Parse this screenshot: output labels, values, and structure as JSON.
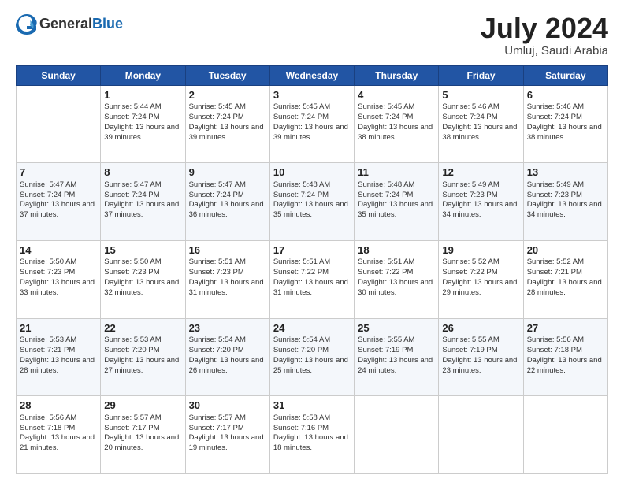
{
  "header": {
    "logo_general": "General",
    "logo_blue": "Blue",
    "month_title": "July 2024",
    "location": "Umluj, Saudi Arabia"
  },
  "days_of_week": [
    "Sunday",
    "Monday",
    "Tuesday",
    "Wednesday",
    "Thursday",
    "Friday",
    "Saturday"
  ],
  "weeks": [
    [
      {
        "day": null,
        "data": null
      },
      {
        "day": 1,
        "sunrise": "Sunrise: 5:44 AM",
        "sunset": "Sunset: 7:24 PM",
        "daylight": "Daylight: 13 hours and 39 minutes."
      },
      {
        "day": 2,
        "sunrise": "Sunrise: 5:45 AM",
        "sunset": "Sunset: 7:24 PM",
        "daylight": "Daylight: 13 hours and 39 minutes."
      },
      {
        "day": 3,
        "sunrise": "Sunrise: 5:45 AM",
        "sunset": "Sunset: 7:24 PM",
        "daylight": "Daylight: 13 hours and 39 minutes."
      },
      {
        "day": 4,
        "sunrise": "Sunrise: 5:45 AM",
        "sunset": "Sunset: 7:24 PM",
        "daylight": "Daylight: 13 hours and 38 minutes."
      },
      {
        "day": 5,
        "sunrise": "Sunrise: 5:46 AM",
        "sunset": "Sunset: 7:24 PM",
        "daylight": "Daylight: 13 hours and 38 minutes."
      },
      {
        "day": 6,
        "sunrise": "Sunrise: 5:46 AM",
        "sunset": "Sunset: 7:24 PM",
        "daylight": "Daylight: 13 hours and 38 minutes."
      }
    ],
    [
      {
        "day": 7,
        "sunrise": "Sunrise: 5:47 AM",
        "sunset": "Sunset: 7:24 PM",
        "daylight": "Daylight: 13 hours and 37 minutes."
      },
      {
        "day": 8,
        "sunrise": "Sunrise: 5:47 AM",
        "sunset": "Sunset: 7:24 PM",
        "daylight": "Daylight: 13 hours and 37 minutes."
      },
      {
        "day": 9,
        "sunrise": "Sunrise: 5:47 AM",
        "sunset": "Sunset: 7:24 PM",
        "daylight": "Daylight: 13 hours and 36 minutes."
      },
      {
        "day": 10,
        "sunrise": "Sunrise: 5:48 AM",
        "sunset": "Sunset: 7:24 PM",
        "daylight": "Daylight: 13 hours and 35 minutes."
      },
      {
        "day": 11,
        "sunrise": "Sunrise: 5:48 AM",
        "sunset": "Sunset: 7:24 PM",
        "daylight": "Daylight: 13 hours and 35 minutes."
      },
      {
        "day": 12,
        "sunrise": "Sunrise: 5:49 AM",
        "sunset": "Sunset: 7:23 PM",
        "daylight": "Daylight: 13 hours and 34 minutes."
      },
      {
        "day": 13,
        "sunrise": "Sunrise: 5:49 AM",
        "sunset": "Sunset: 7:23 PM",
        "daylight": "Daylight: 13 hours and 34 minutes."
      }
    ],
    [
      {
        "day": 14,
        "sunrise": "Sunrise: 5:50 AM",
        "sunset": "Sunset: 7:23 PM",
        "daylight": "Daylight: 13 hours and 33 minutes."
      },
      {
        "day": 15,
        "sunrise": "Sunrise: 5:50 AM",
        "sunset": "Sunset: 7:23 PM",
        "daylight": "Daylight: 13 hours and 32 minutes."
      },
      {
        "day": 16,
        "sunrise": "Sunrise: 5:51 AM",
        "sunset": "Sunset: 7:23 PM",
        "daylight": "Daylight: 13 hours and 31 minutes."
      },
      {
        "day": 17,
        "sunrise": "Sunrise: 5:51 AM",
        "sunset": "Sunset: 7:22 PM",
        "daylight": "Daylight: 13 hours and 31 minutes."
      },
      {
        "day": 18,
        "sunrise": "Sunrise: 5:51 AM",
        "sunset": "Sunset: 7:22 PM",
        "daylight": "Daylight: 13 hours and 30 minutes."
      },
      {
        "day": 19,
        "sunrise": "Sunrise: 5:52 AM",
        "sunset": "Sunset: 7:22 PM",
        "daylight": "Daylight: 13 hours and 29 minutes."
      },
      {
        "day": 20,
        "sunrise": "Sunrise: 5:52 AM",
        "sunset": "Sunset: 7:21 PM",
        "daylight": "Daylight: 13 hours and 28 minutes."
      }
    ],
    [
      {
        "day": 21,
        "sunrise": "Sunrise: 5:53 AM",
        "sunset": "Sunset: 7:21 PM",
        "daylight": "Daylight: 13 hours and 28 minutes."
      },
      {
        "day": 22,
        "sunrise": "Sunrise: 5:53 AM",
        "sunset": "Sunset: 7:20 PM",
        "daylight": "Daylight: 13 hours and 27 minutes."
      },
      {
        "day": 23,
        "sunrise": "Sunrise: 5:54 AM",
        "sunset": "Sunset: 7:20 PM",
        "daylight": "Daylight: 13 hours and 26 minutes."
      },
      {
        "day": 24,
        "sunrise": "Sunrise: 5:54 AM",
        "sunset": "Sunset: 7:20 PM",
        "daylight": "Daylight: 13 hours and 25 minutes."
      },
      {
        "day": 25,
        "sunrise": "Sunrise: 5:55 AM",
        "sunset": "Sunset: 7:19 PM",
        "daylight": "Daylight: 13 hours and 24 minutes."
      },
      {
        "day": 26,
        "sunrise": "Sunrise: 5:55 AM",
        "sunset": "Sunset: 7:19 PM",
        "daylight": "Daylight: 13 hours and 23 minutes."
      },
      {
        "day": 27,
        "sunrise": "Sunrise: 5:56 AM",
        "sunset": "Sunset: 7:18 PM",
        "daylight": "Daylight: 13 hours and 22 minutes."
      }
    ],
    [
      {
        "day": 28,
        "sunrise": "Sunrise: 5:56 AM",
        "sunset": "Sunset: 7:18 PM",
        "daylight": "Daylight: 13 hours and 21 minutes."
      },
      {
        "day": 29,
        "sunrise": "Sunrise: 5:57 AM",
        "sunset": "Sunset: 7:17 PM",
        "daylight": "Daylight: 13 hours and 20 minutes."
      },
      {
        "day": 30,
        "sunrise": "Sunrise: 5:57 AM",
        "sunset": "Sunset: 7:17 PM",
        "daylight": "Daylight: 13 hours and 19 minutes."
      },
      {
        "day": 31,
        "sunrise": "Sunrise: 5:58 AM",
        "sunset": "Sunset: 7:16 PM",
        "daylight": "Daylight: 13 hours and 18 minutes."
      },
      {
        "day": null,
        "data": null
      },
      {
        "day": null,
        "data": null
      },
      {
        "day": null,
        "data": null
      }
    ]
  ]
}
